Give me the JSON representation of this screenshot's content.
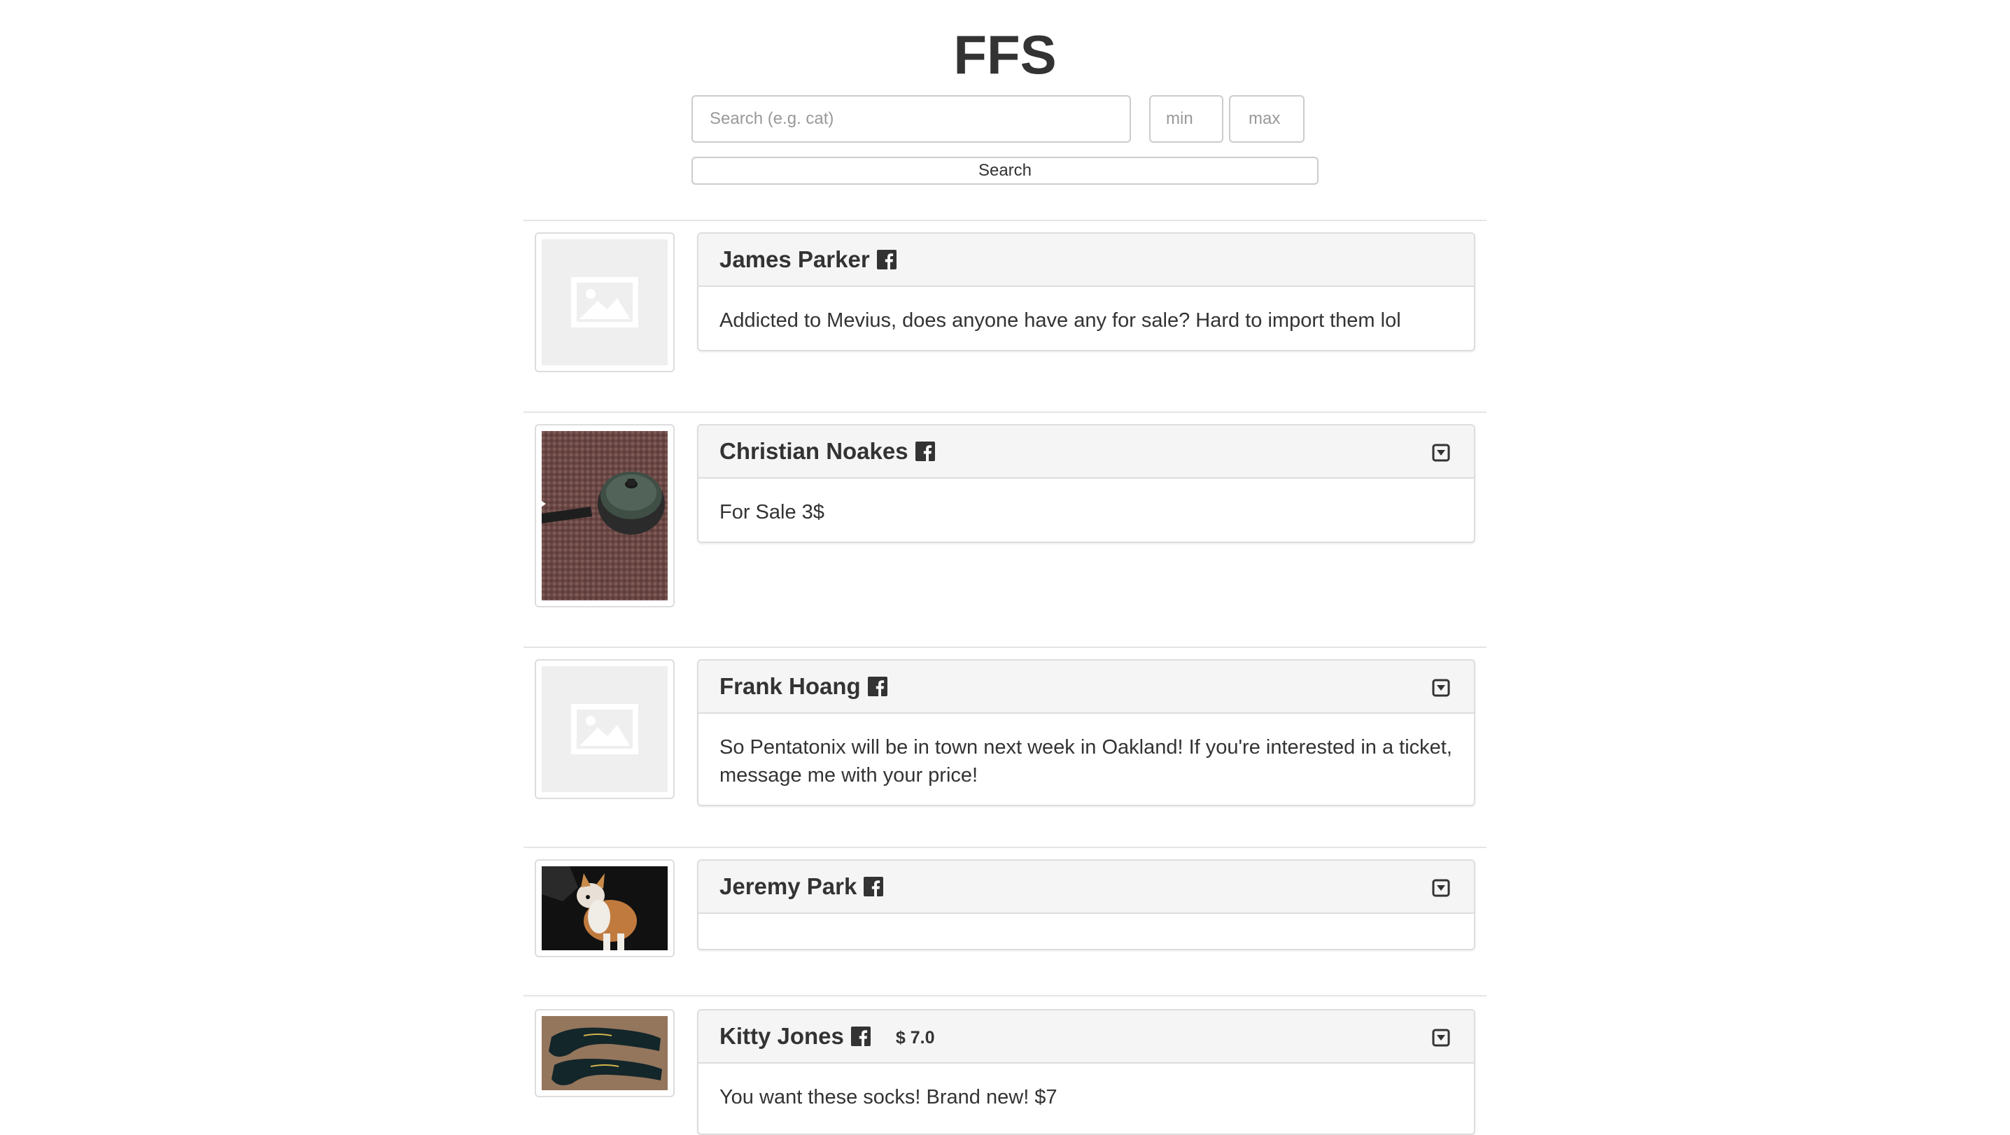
{
  "header": {
    "title": "FFS"
  },
  "search": {
    "query_placeholder": "Search (e.g. cat)",
    "query_value": "",
    "min_placeholder": "min",
    "max_placeholder": "max",
    "button_label": "Search"
  },
  "posts": [
    {
      "name": "James Parker",
      "price": "",
      "body": "Addicted to Mevius, does anyone have any for sale? Hard to import them lol",
      "image": "placeholder-image",
      "has_menu": false
    },
    {
      "name": "Christian Noakes",
      "price": "",
      "body": "For Sale 3$",
      "image": "saucepan-photo",
      "has_menu": true
    },
    {
      "name": "Frank Hoang",
      "price": "",
      "body": "So Pentatonix will be in town next week in Oakland! If you're interested in a ticket, message me with your price!",
      "image": "placeholder-image",
      "has_menu": true
    },
    {
      "name": "Jeremy Park",
      "price": "",
      "body": "",
      "image": "corgi-photo",
      "has_menu": true
    },
    {
      "name": "Kitty Jones",
      "price": "$ 7.0",
      "body": "You want these socks! Brand new! $7",
      "image": "socks-photo",
      "has_menu": true
    }
  ],
  "colors": {
    "panel_heading_bg": "#f5f5f5",
    "border": "#dddddd",
    "text": "#333333"
  }
}
